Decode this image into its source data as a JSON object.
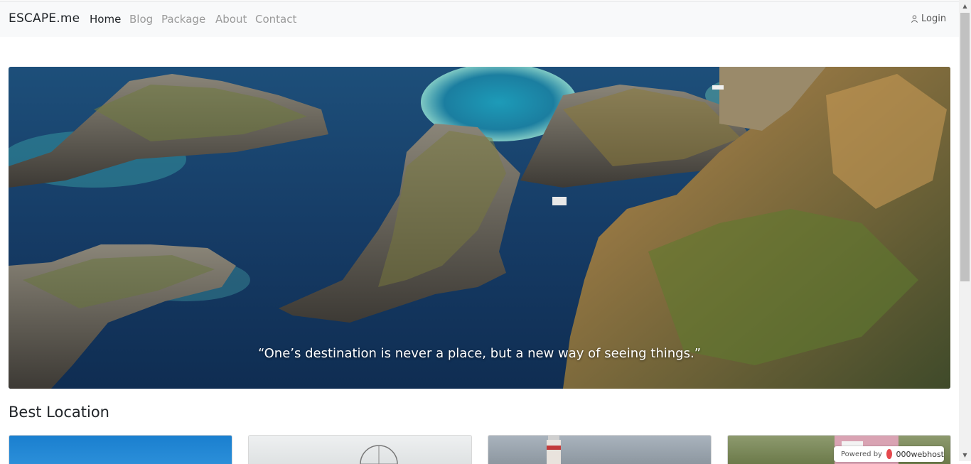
{
  "nav": {
    "brand": "ESCAPE.me",
    "links": [
      "Home",
      "Blog",
      "Package",
      "About",
      "Contact"
    ],
    "login": "Login"
  },
  "hero": {
    "quote": "“One’s destination is never a place, but a new way of seeing things.”"
  },
  "section": {
    "title": "Best Location"
  },
  "badge": {
    "powered": "Powered by",
    "host": "000webhost"
  }
}
